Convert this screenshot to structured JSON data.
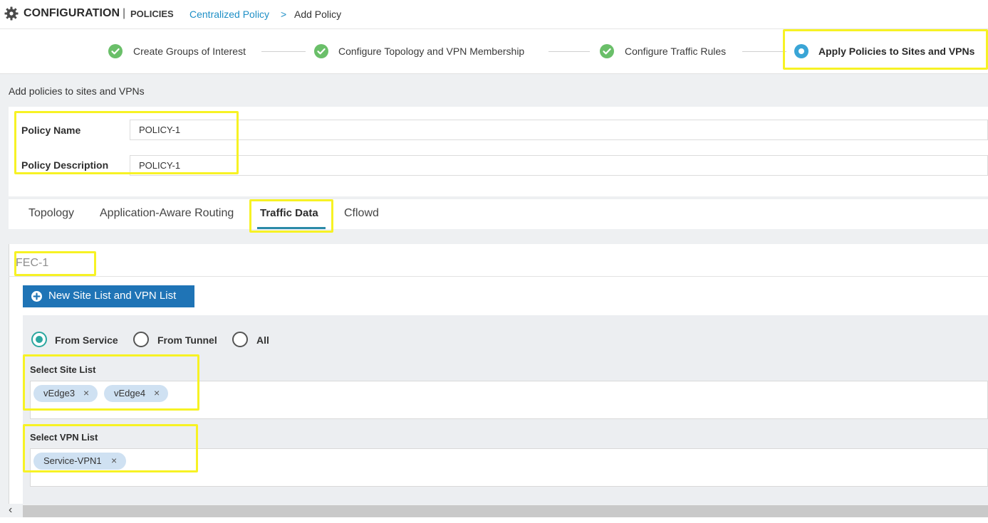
{
  "header": {
    "title": "CONFIGURATION",
    "separator": "|",
    "subtitle": "POLICIES",
    "breadcrumb_link": "Centralized Policy",
    "breadcrumb_separator": ">",
    "breadcrumb_current": "Add Policy"
  },
  "stepper": {
    "steps": [
      {
        "label": "Create Groups of Interest",
        "status": "complete"
      },
      {
        "label": "Configure Topology and VPN Membership",
        "status": "complete"
      },
      {
        "label": "Configure Traffic Rules",
        "status": "complete"
      },
      {
        "label": "Apply Policies to Sites and VPNs",
        "status": "current"
      }
    ]
  },
  "section_heading": "Add policies to sites and VPNs",
  "policy": {
    "name_label": "Policy Name",
    "name_value": "POLICY-1",
    "description_label": "Policy Description",
    "description_value": "POLICY-1"
  },
  "tabs": [
    {
      "label": "Topology",
      "active": false
    },
    {
      "label": "Application-Aware Routing",
      "active": false
    },
    {
      "label": "Traffic Data",
      "active": true
    },
    {
      "label": "Cflowd",
      "active": false
    }
  ],
  "fec": {
    "name": "FEC-1",
    "new_button": "New Site List and VPN List",
    "direction": {
      "options": [
        "From Service",
        "From Tunnel",
        "All"
      ],
      "selected": "From Service"
    },
    "site_list": {
      "label": "Select Site List",
      "chips": [
        "vEdge3",
        "vEdge4"
      ]
    },
    "vpn_list": {
      "label": "Select VPN List",
      "chips": [
        "Service-VPN1"
      ]
    }
  },
  "chip_remove_glyph": "×",
  "scroll_left_glyph": "‹",
  "colors": {
    "accent": "#1f74b6",
    "link": "#1e8fc6",
    "complete": "#6abf69",
    "current": "#3aa5d6",
    "highlight": "#f7f224",
    "tab_underline": "#2b8aa8",
    "radio_selected": "#2ba7a0",
    "chip": "#cfe1f2"
  }
}
